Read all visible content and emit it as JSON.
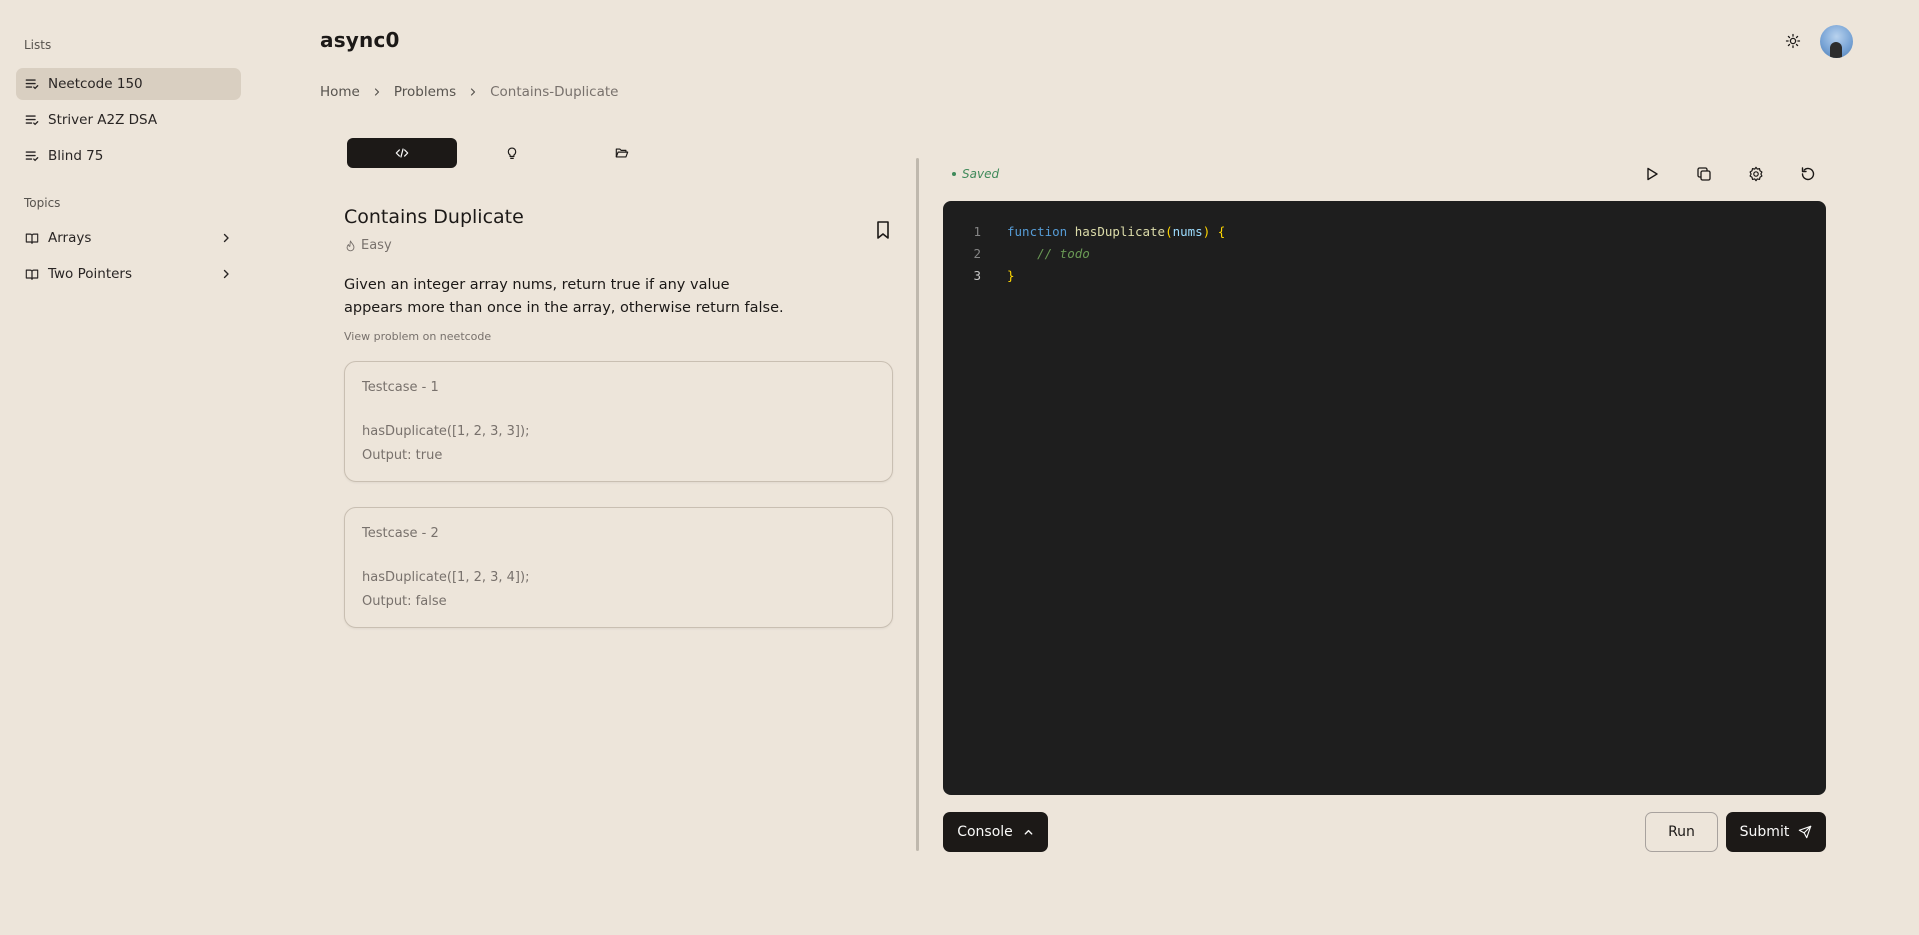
{
  "app": {
    "brand": "async0"
  },
  "colors": {
    "background": "#ede5da",
    "active_item": "#d9cfc1",
    "primary": "#1c1917",
    "editor_bg": "#1e1e1e",
    "saved": "#3f8a5a"
  },
  "sidebar": {
    "lists_title": "Lists",
    "lists": [
      {
        "label": "Neetcode 150",
        "icon": "list-check-icon",
        "active": true
      },
      {
        "label": "Striver A2Z DSA",
        "icon": "list-check-icon",
        "active": false
      },
      {
        "label": "Blind 75",
        "icon": "list-check-icon",
        "active": false
      }
    ],
    "topics_title": "Topics",
    "topics": [
      {
        "label": "Arrays",
        "icon": "book-open-icon"
      },
      {
        "label": "Two Pointers",
        "icon": "book-open-icon"
      }
    ]
  },
  "header": {
    "theme_icon": "sun-icon",
    "avatar": "user-avatar"
  },
  "breadcrumb": {
    "home": "Home",
    "problems": "Problems",
    "current": "Contains-Duplicate"
  },
  "tabs": [
    {
      "icon": "code-icon",
      "active": true
    },
    {
      "icon": "lightbulb-icon",
      "active": false
    },
    {
      "icon": "folder-open-icon",
      "active": false
    }
  ],
  "problem": {
    "title": "Contains Duplicate",
    "difficulty": "Easy",
    "description": "Given an integer array nums, return true if any value appears more than once in the array, otherwise return false.",
    "link_text": "View problem on neetcode",
    "testcases": [
      {
        "title": "Testcase - 1",
        "code": "hasDuplicate([1, 2, 3, 3]);",
        "output": "Output: true"
      },
      {
        "title": "Testcase - 2",
        "code": "hasDuplicate([1, 2, 3, 4]);",
        "output": "Output: false"
      }
    ]
  },
  "editor": {
    "status": "Saved",
    "toolbar_icons": [
      "play-icon",
      "copy-icon",
      "settings-icon",
      "reset-icon"
    ],
    "lines": [
      {
        "n": "1",
        "kw": "function",
        "fn": "hasDuplicate",
        "p_open": "(",
        "param": "nums",
        "p_close": ")",
        "brace": "{"
      },
      {
        "n": "2",
        "comment": "// todo"
      },
      {
        "n": "3",
        "brace": "}"
      }
    ]
  },
  "footer": {
    "console": "Console",
    "run": "Run",
    "submit": "Submit"
  }
}
